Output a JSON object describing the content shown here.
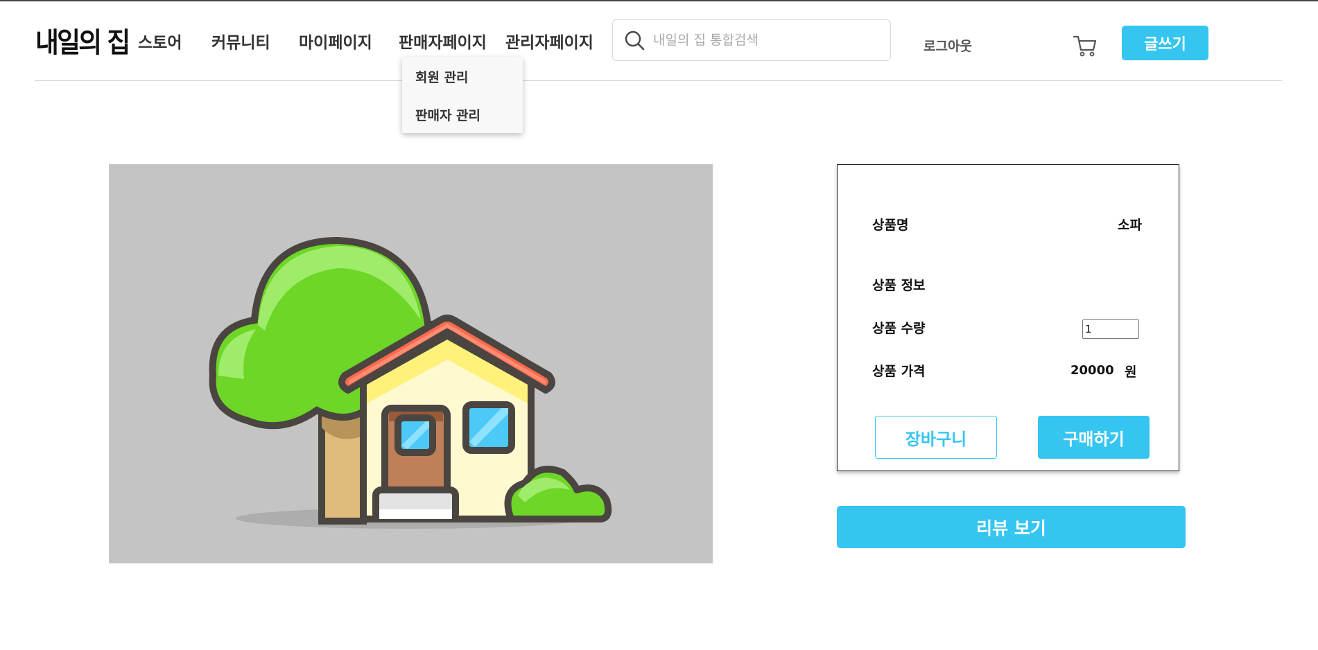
{
  "header": {
    "logo": "내일의 집",
    "nav": [
      {
        "label": "스토어"
      },
      {
        "label": "커뮤니티"
      },
      {
        "label": "마이페이지"
      },
      {
        "label": "판매자페이지"
      },
      {
        "label": "관리자페이지"
      }
    ],
    "search": {
      "placeholder": "내일의 집 통합검색",
      "value": ""
    },
    "logout_label": "로그아웃",
    "cart_icon": "cart-icon",
    "write_label": "글쓰기"
  },
  "dropdown": {
    "items": [
      {
        "label": "회원 관리"
      },
      {
        "label": "판매자 관리"
      }
    ]
  },
  "product": {
    "image_icon": "house-with-tree-illustration",
    "name_label": "상품명",
    "name_value": "소파",
    "info_label": "상품 정보",
    "qty_label": "상품 수량",
    "qty_value": "1",
    "price_label": "상품 가격",
    "price_value": "20000",
    "price_unit": "원",
    "cart_button": "장바구니",
    "buy_button": "구매하기",
    "review_button": "리뷰 보기"
  },
  "colors": {
    "accent": "#35c5f0",
    "image_background": "#c4c4c4"
  }
}
